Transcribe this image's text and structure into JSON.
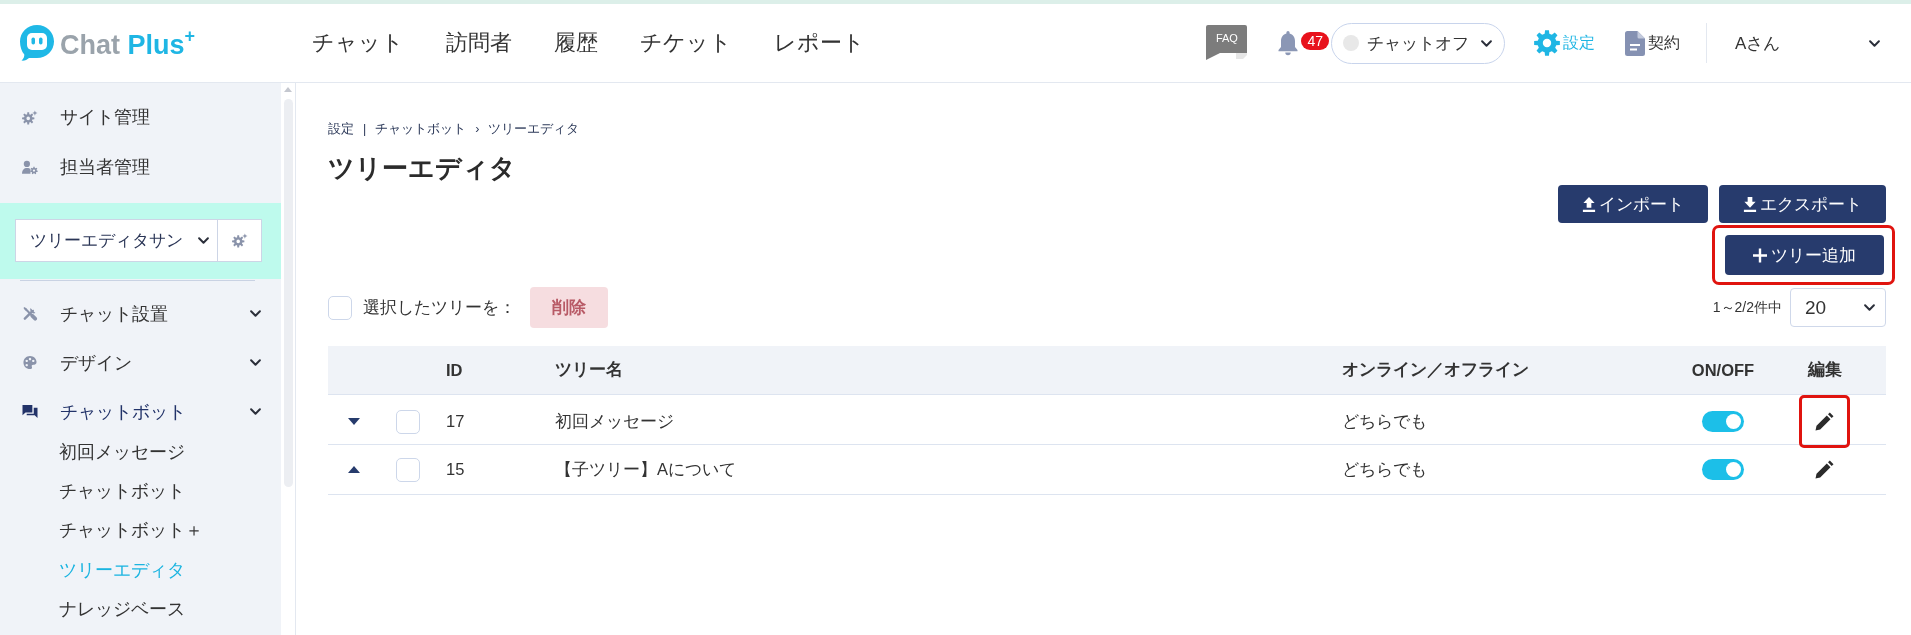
{
  "header": {
    "logo": {
      "name": "Chat",
      "accent": "Plus",
      "mark": "+"
    },
    "nav": [
      {
        "label": "チャット",
        "selected": false
      },
      {
        "label": "訪問者",
        "selected": false
      },
      {
        "label": "履歴",
        "selected": false
      },
      {
        "label": "チケット",
        "selected": false
      },
      {
        "label": "レポート",
        "selected": false
      }
    ],
    "faq": {
      "label": "FAQ"
    },
    "notifications": {
      "count": "47"
    },
    "status": {
      "label": "チャットオフ",
      "online": false
    },
    "links": [
      {
        "label": "設定",
        "kind": "gear",
        "selected": true
      },
      {
        "label": "契約",
        "kind": "document",
        "selected": false
      }
    ],
    "user": {
      "name": "Aさん"
    }
  },
  "sidebar": {
    "items": [
      {
        "label": "サイト管理",
        "kind": "gear"
      },
      {
        "label": "担当者管理",
        "kind": "user-gear"
      }
    ],
    "site_select": {
      "value": "ツリーエディタサン"
    },
    "sections": [
      {
        "label": "チャット設置",
        "kind": "tools",
        "expanded": false
      },
      {
        "label": "デザイン",
        "kind": "palette",
        "expanded": false
      },
      {
        "label": "チャットボット",
        "kind": "chat",
        "expanded": true,
        "children": [
          {
            "label": "初回メッセージ",
            "selected": false
          },
          {
            "label": "チャットボット",
            "selected": false
          },
          {
            "label": "チャットボット＋",
            "selected": false
          },
          {
            "label": "ツリーエディタ",
            "selected": true
          },
          {
            "label": "ナレッジベース",
            "selected": false
          }
        ]
      }
    ]
  },
  "main": {
    "breadcrumb": [
      {
        "label": "設定"
      },
      {
        "separator": "|",
        "label": "チャットボット"
      },
      {
        "separator": "›",
        "label": "ツリーエディタ"
      }
    ],
    "title": "ツリーエディタ",
    "actions": [
      {
        "label": "インポート",
        "kind": "upload",
        "highlighted": false
      },
      {
        "label": "エクスポート",
        "kind": "download",
        "highlighted": false
      }
    ],
    "add_button": {
      "label": "ツリー追加",
      "kind": "plus",
      "highlighted": true
    },
    "bulk": {
      "checked": false,
      "label": "選択したツリーを：",
      "button": "削除",
      "disabled": true
    },
    "pagination": {
      "summary": "1～2/2件中",
      "page_size": "20"
    },
    "table": {
      "columns": [
        "ID",
        "ツリー名",
        "オンライン／オフライン",
        "ON/OFF",
        "編集"
      ],
      "rows": [
        {
          "kind": "move-down",
          "checked": false,
          "id": "17",
          "name": "初回メッセージ",
          "availability": "どちらでも",
          "on": true,
          "edit_highlighted": true
        },
        {
          "kind": "move-up",
          "checked": false,
          "id": "15",
          "name": "【子ツリー】Aについて",
          "availability": "どちらでも",
          "on": true,
          "edit_highlighted": false
        }
      ]
    }
  }
}
